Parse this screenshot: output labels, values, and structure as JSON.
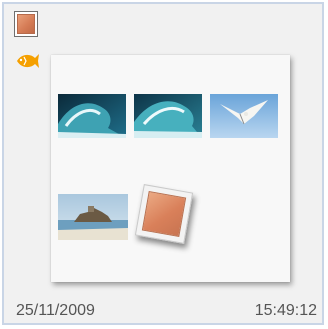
{
  "tile": {
    "date": "25/11/2009",
    "time": "15:49:12"
  },
  "icons": {
    "album": "album-icon",
    "badge": "fish-icon"
  },
  "preview": {
    "thumbnails": [
      {
        "subject": "ocean wave"
      },
      {
        "subject": "ocean wave"
      },
      {
        "subject": "seagull in sky"
      },
      {
        "subject": "island with rocks"
      }
    ],
    "nested_item": "album-icon"
  },
  "colors": {
    "tile_border": "#c9d5e6",
    "tile_background": "#f1f1f1",
    "album_color": "#d9805a",
    "badge_color": "#f5a000",
    "text": "#555555"
  }
}
